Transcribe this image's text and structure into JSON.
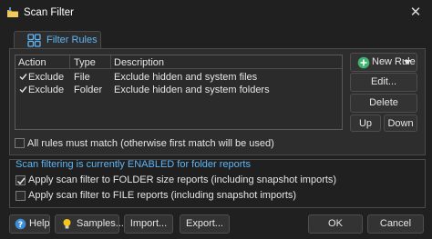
{
  "window": {
    "title": "Scan Filter",
    "close_glyph": "✕"
  },
  "tab": {
    "label": "Filter Rules",
    "icon": "grid-icon"
  },
  "rules_table": {
    "columns": [
      "Action",
      "Type",
      "Description"
    ],
    "rows": [
      {
        "checked": true,
        "action": "Exclude",
        "type": "File",
        "description": "Exclude hidden and system files"
      },
      {
        "checked": true,
        "action": "Exclude",
        "type": "Folder",
        "description": "Exclude hidden and system folders"
      }
    ]
  },
  "rule_buttons": {
    "new_rule": "New Rule",
    "edit": "Edit...",
    "delete": "Delete",
    "up": "Up",
    "down": "Down"
  },
  "all_rules_must_match": {
    "checked": false,
    "label": "All rules must match (otherwise first match will be used)"
  },
  "scan_group": {
    "status": "Scan filtering is currently ENABLED for folder reports",
    "folder_option": {
      "checked": true,
      "label": "Apply scan filter to FOLDER size reports (including snapshot imports)"
    },
    "file_option": {
      "checked": false,
      "label": "Apply scan filter to FILE reports (including snapshot imports)"
    }
  },
  "footer": {
    "help": "Help",
    "samples": "Samples...",
    "import": "Import...",
    "export": "Export...",
    "ok": "OK",
    "cancel": "Cancel"
  },
  "colors": {
    "accent": "#5fb6f5",
    "background": "#202020",
    "panel": "#2d2d2d",
    "new_rule_icon": "#3cb371"
  }
}
